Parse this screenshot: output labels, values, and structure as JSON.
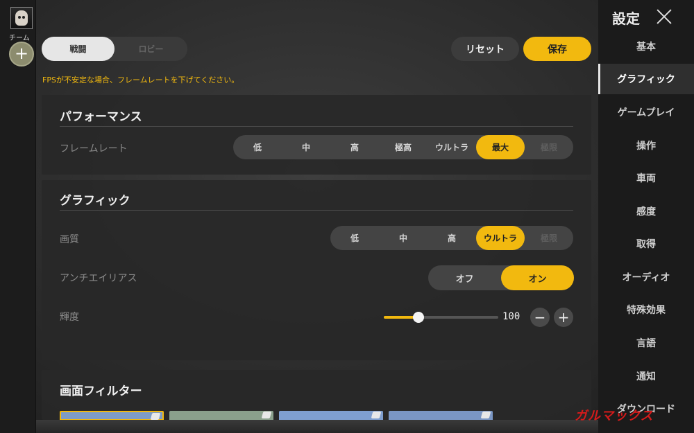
{
  "left_rail": {
    "team_label": "チーム",
    "add_label": "+"
  },
  "toolbar": {
    "mode_tabs": [
      {
        "label": "戦闘",
        "active": true
      },
      {
        "label": "ロビー",
        "active": false
      }
    ],
    "reset_label": "リセット",
    "save_label": "保存",
    "warning": "FPSが不安定な場合、フレームレートを下げてください。"
  },
  "performance": {
    "title": "パフォーマンス",
    "framerate_label": "フレームレート",
    "framerate_options": [
      "低",
      "中",
      "高",
      "極高",
      "ウルトラ",
      "最大",
      "極限"
    ],
    "framerate_selected": "最大"
  },
  "graphics": {
    "title": "グラフィック",
    "quality_label": "画質",
    "quality_options": [
      "低",
      "中",
      "高",
      "ウルトラ",
      "極限"
    ],
    "quality_selected": "ウルトラ",
    "aa_label": "アンチエイリアス",
    "aa_off": "オフ",
    "aa_on": "オン",
    "aa_selected": "オン",
    "brightness_label": "輝度",
    "brightness_value": "100",
    "brightness_fraction": 0.3,
    "minus": "−",
    "plus": "+"
  },
  "filters": {
    "title": "画面フィルター"
  },
  "sidebar": {
    "title": "設定",
    "items": [
      {
        "label": "基本"
      },
      {
        "label": "グラフィック",
        "active": true
      },
      {
        "label": "ゲームプレイ"
      },
      {
        "label": "操作"
      },
      {
        "label": "車両"
      },
      {
        "label": "感度"
      },
      {
        "label": "取得"
      },
      {
        "label": "オーディオ"
      },
      {
        "label": "特殊効果"
      },
      {
        "label": "言語"
      },
      {
        "label": "通知"
      },
      {
        "label": "ダウンロード"
      }
    ]
  },
  "watermark": "ガルマックス",
  "colors": {
    "accent": "#f2b90f",
    "panel": "#282828",
    "sidebar": "#1b1b1b"
  }
}
